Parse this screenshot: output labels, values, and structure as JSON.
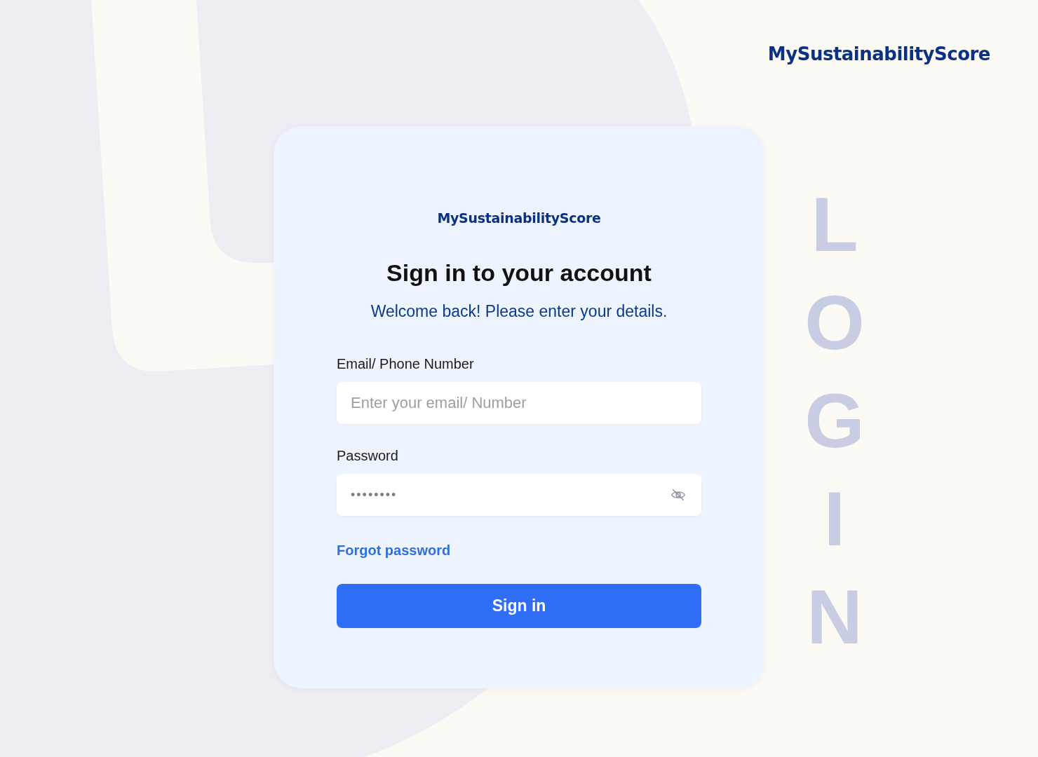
{
  "brand": "MySustainabilityScore",
  "card": {
    "brand": "MySustainabilityScore",
    "title": "Sign in to your account",
    "subtitle": "Welcome back! Please enter your details.",
    "fields": [
      {
        "kind": "text",
        "label": "Email/ Phone Number",
        "placeholder": "Enter your email/ Number"
      },
      {
        "kind": "password",
        "label": "Password",
        "value": "••••••••"
      }
    ],
    "forgot_link": "Forgot password",
    "submit": "Sign in"
  },
  "side_word": [
    "L",
    "O",
    "G",
    "I",
    "N"
  ]
}
